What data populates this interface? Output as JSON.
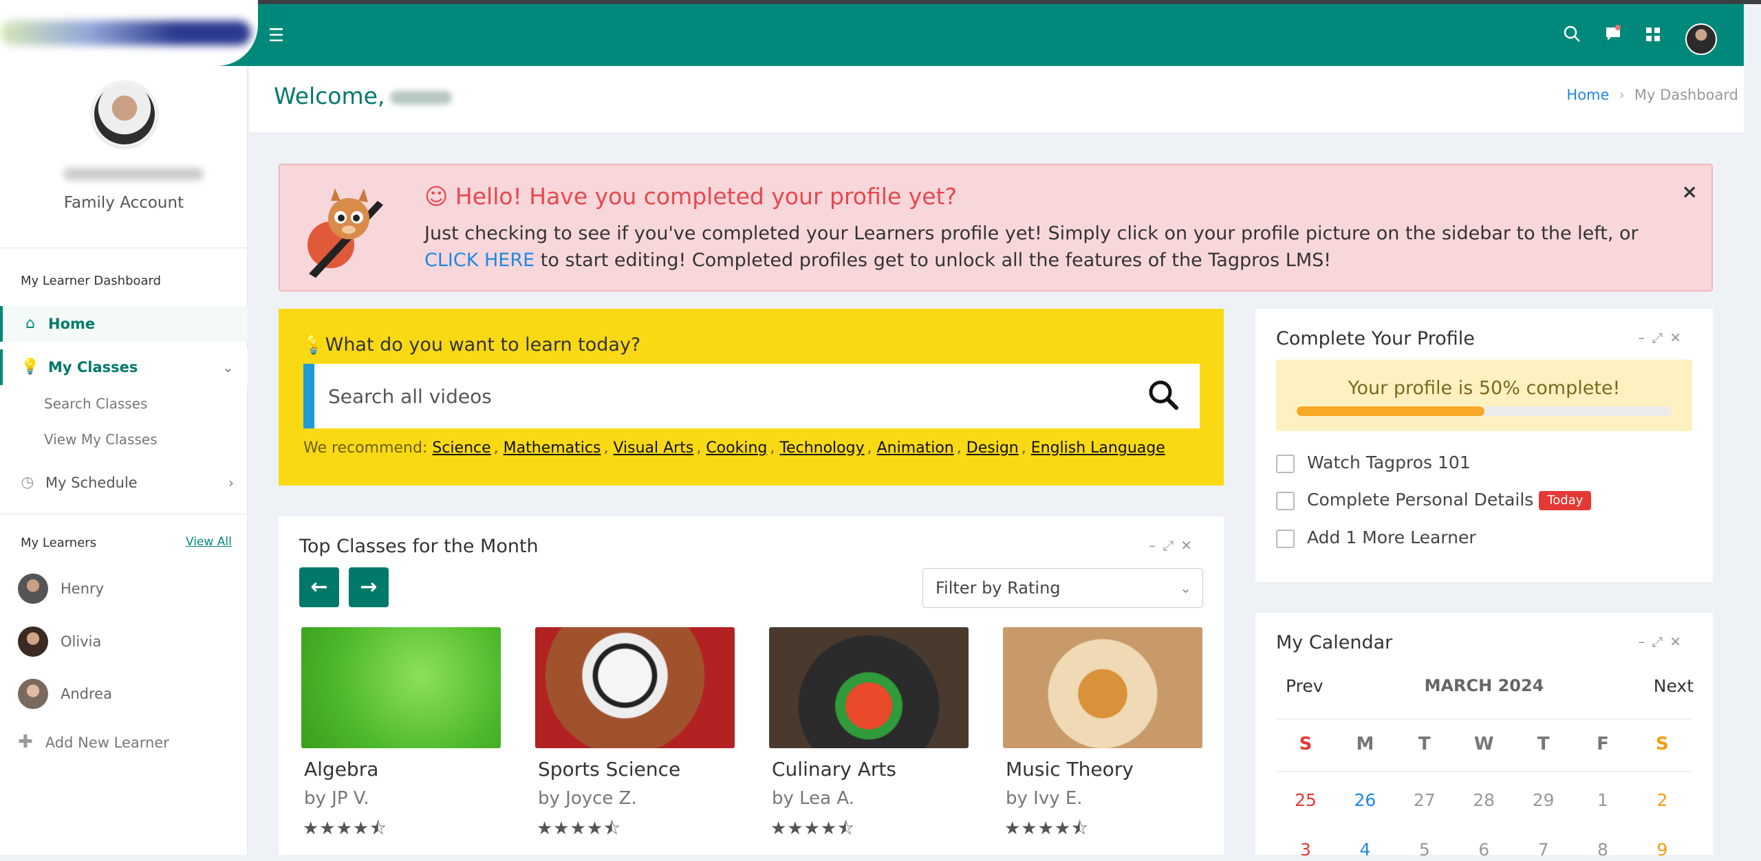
{
  "topbar": {
    "menu_icon": "hamburger-icon",
    "icons": [
      "search-icon",
      "chat-icon",
      "apps-grid-icon"
    ]
  },
  "sidebar": {
    "account_type": "Family Account",
    "dashboard_section": "My Learner Dashboard",
    "nav": [
      {
        "label": "Home",
        "icon": "home-icon",
        "active": true
      },
      {
        "label": "My Classes",
        "icon": "lightbulb-icon",
        "expanded": true,
        "children": [
          "Search Classes",
          "View My Classes"
        ]
      },
      {
        "label": "My Schedule",
        "icon": "clock-icon"
      }
    ],
    "learners_section": "My Learners",
    "view_all": "View All",
    "learners": [
      "Henry",
      "Olivia",
      "Andrea"
    ],
    "add_learner": "Add New Learner"
  },
  "header": {
    "welcome": "Welcome,",
    "breadcrumb": [
      "Home",
      "My Dashboard"
    ]
  },
  "alert": {
    "title": "Hello! Have you completed your profile yet?",
    "body_before": "Just checking to see if you've completed your Learners profile yet! Simply click on your profile picture on the sidebar to the left, or ",
    "link": "CLICK HERE",
    "body_after": " to start editing! Completed profiles get to unlock all the features of the Tagpros LMS!",
    "close": "×"
  },
  "learn": {
    "title": "What do you want to learn today?",
    "placeholder": "Search all videos",
    "recommend_label": "We recommend:",
    "topics": [
      "Science",
      "Mathematics",
      "Visual Arts",
      "Cooking",
      "Technology",
      "Animation",
      "Design",
      "English Language"
    ]
  },
  "top_classes": {
    "title": "Top Classes for the Month",
    "filter": "Filter by Rating",
    "classes": [
      {
        "name": "Algebra",
        "by": "by JP V.",
        "rating": 4.5
      },
      {
        "name": "Sports Science",
        "by": "by Joyce Z.",
        "rating": 4.5
      },
      {
        "name": "Culinary Arts",
        "by": "by Lea A.",
        "rating": 4.5
      },
      {
        "name": "Music Theory",
        "by": "by Ivy E.",
        "rating": 4.5
      }
    ]
  },
  "profile": {
    "title": "Complete Your Profile",
    "progress_text": "Your profile is 50% complete!",
    "progress": 50,
    "tasks": [
      {
        "label": "Watch Tagpros 101"
      },
      {
        "label": "Complete Personal Details",
        "badge": "Today"
      },
      {
        "label": "Add 1 More Learner"
      }
    ]
  },
  "calendar": {
    "title": "My Calendar",
    "prev": "Prev",
    "next": "Next",
    "month": "MARCH 2024",
    "weekdays": [
      "S",
      "M",
      "T",
      "W",
      "T",
      "F",
      "S"
    ],
    "week1": [
      "25",
      "26",
      "27",
      "28",
      "29",
      "1",
      "2"
    ],
    "week2": [
      "3",
      "4",
      "5",
      "6",
      "7",
      "8",
      "9"
    ]
  },
  "colors": {
    "brand": "#00897b",
    "alert_bg": "#f8d7da",
    "learn_bg": "#f9d914",
    "sunday": "#e53935",
    "saturday": "#f39c12",
    "today": "#1e88e5"
  }
}
